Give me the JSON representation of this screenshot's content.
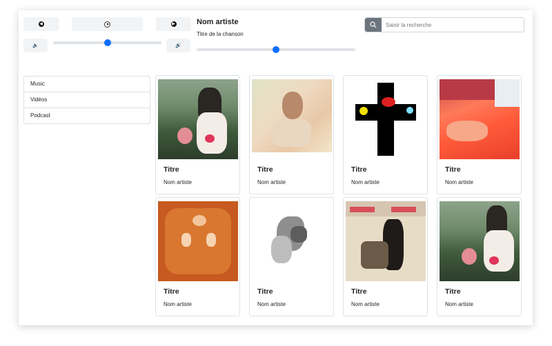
{
  "player": {
    "prev_icon": "arrow-left-circle-icon",
    "play_icon": "play-circle-icon",
    "next_icon": "arrow-right-circle-icon",
    "volume_down_icon": "volume-down-icon",
    "volume_up_icon": "volume-up-icon",
    "volume_level": 0.5,
    "progress_level": 0.5,
    "artist": "Nom artiste",
    "song": "Titre de la chanson"
  },
  "search": {
    "placeholder": "Saisir la recherche",
    "icon": "search-icon"
  },
  "sidebar": {
    "items": [
      {
        "label": "Music"
      },
      {
        "label": "Vidéos"
      },
      {
        "label": "Podcast"
      }
    ]
  },
  "cards": [
    {
      "title": "Titre",
      "artist": "Nom artiste"
    },
    {
      "title": "Titre",
      "artist": "Nom artiste"
    },
    {
      "title": "Titre",
      "artist": "Nom artiste"
    },
    {
      "title": "Titre",
      "artist": "Nom artiste"
    },
    {
      "title": "Titre",
      "artist": "Nom artiste"
    },
    {
      "title": "Titre",
      "artist": "Nom artiste"
    },
    {
      "title": "Titre",
      "artist": "Nom artiste"
    },
    {
      "title": "Titre",
      "artist": "Nom artiste"
    }
  ],
  "colors": {
    "accent": "#0d6efd",
    "search_button": "#6c757d"
  }
}
